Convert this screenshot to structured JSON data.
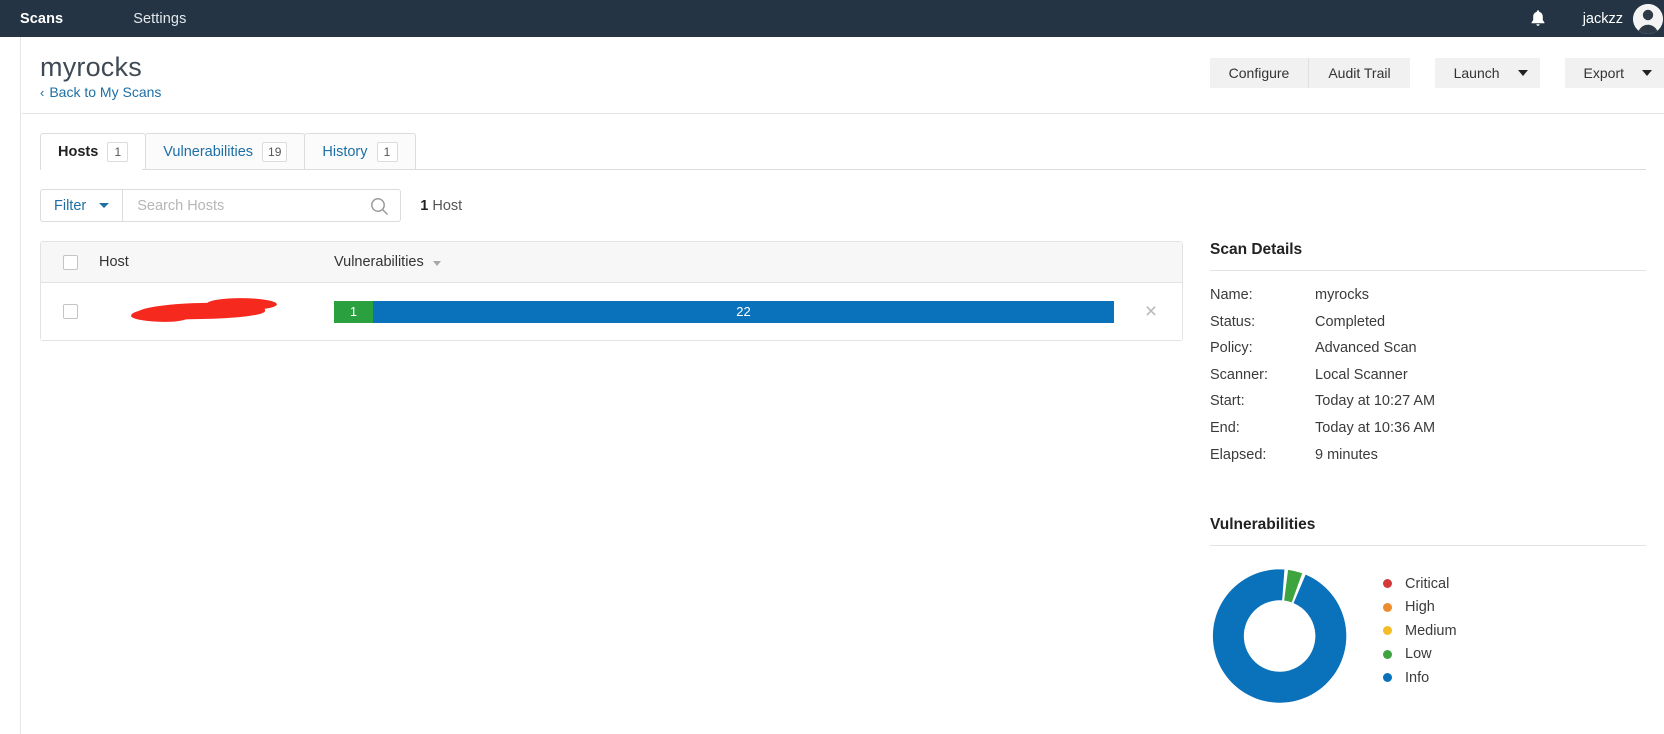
{
  "topnav": {
    "items": [
      {
        "label": "Scans",
        "active": true
      },
      {
        "label": "Settings",
        "active": false
      }
    ],
    "bell_icon": "bell-icon",
    "username": "jackzz",
    "avatar_icon": "user-avatar-icon"
  },
  "header": {
    "title": "myrocks",
    "back_link": "Back to My Scans",
    "back_chevron": "‹",
    "actions": {
      "configure": "Configure",
      "audit_trail": "Audit Trail",
      "launch": "Launch",
      "export": "Export"
    }
  },
  "tabs": [
    {
      "label": "Hosts",
      "count": "1",
      "active": true
    },
    {
      "label": "Vulnerabilities",
      "count": "19",
      "active": false
    },
    {
      "label": "History",
      "count": "1",
      "active": false
    }
  ],
  "filterbar": {
    "filter_label": "Filter",
    "search_placeholder": "Search Hosts",
    "search_value": "",
    "search_icon": "search-icon",
    "count_number": "1",
    "count_label": "Host"
  },
  "table": {
    "columns": {
      "host": "Host",
      "vulnerabilities": "Vulnerabilities"
    },
    "rows": [
      {
        "host": "",
        "host_redacted": true,
        "segments": [
          {
            "severity": "Low",
            "value": "1",
            "color": "#2ba03f"
          },
          {
            "severity": "Info",
            "value": "22",
            "color": "#0a72bb"
          }
        ],
        "remove_icon": "×"
      }
    ]
  },
  "scan_details": {
    "title": "Scan Details",
    "fields": [
      {
        "label": "Name:",
        "value": "myrocks"
      },
      {
        "label": "Status:",
        "value": "Completed"
      },
      {
        "label": "Policy:",
        "value": "Advanced Scan"
      },
      {
        "label": "Scanner:",
        "value": "Local Scanner"
      },
      {
        "label": "Start:",
        "value": "Today at 10:27 AM"
      },
      {
        "label": "End:",
        "value": "Today at 10:36 AM"
      },
      {
        "label": "Elapsed:",
        "value": "9 minutes"
      }
    ]
  },
  "vulnerabilities_panel": {
    "title": "Vulnerabilities"
  },
  "chart_data": {
    "type": "pie",
    "title": "Vulnerabilities",
    "donut": true,
    "categories": [
      "Critical",
      "High",
      "Medium",
      "Low",
      "Info"
    ],
    "values": [
      0,
      0,
      0,
      1,
      22
    ],
    "colors": [
      "#d53a3a",
      "#ee8b2c",
      "#f5bc28",
      "#3da43f",
      "#0a72bb"
    ],
    "legend_position": "right",
    "total": 23
  },
  "colors": {
    "navbar": "#243444",
    "accent_link": "#1d6fa5",
    "info": "#0a72bb",
    "low": "#2ba03f",
    "redaction": "#f6291e"
  }
}
